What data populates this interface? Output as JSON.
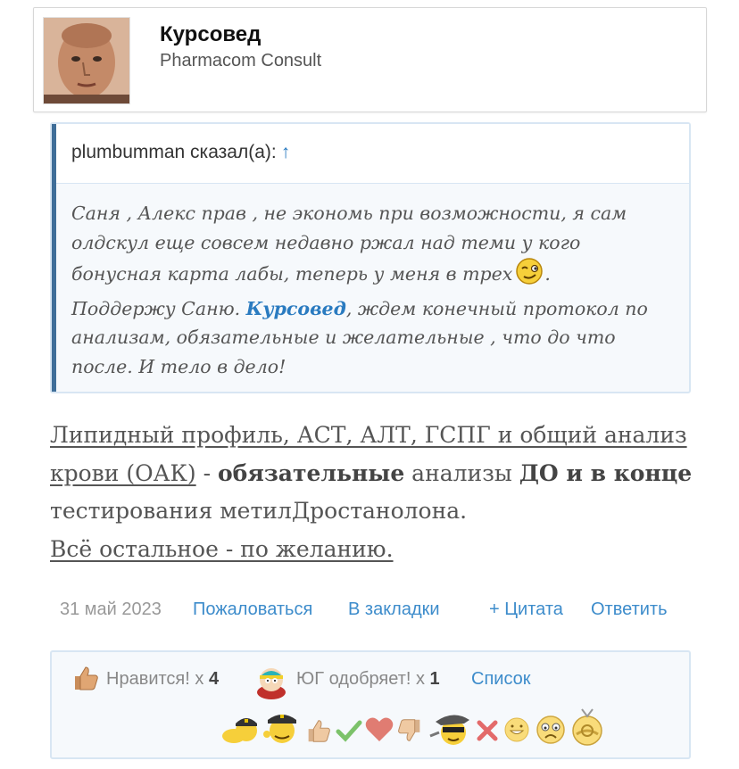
{
  "author": {
    "name": "Курсовед",
    "title": "Pharmacom Consult"
  },
  "quote": {
    "author": "plumbumman сказал(а):",
    "arrow": "↑",
    "line1": "Саня , Алекс прав , не экономь при возможности, я сам",
    "line2": "олдскул еще совсем недавно ржал над теми у кого",
    "line3": "бонусная карта лабы, теперь у меня в трех",
    "line3_end": ".",
    "line4_pre": "Поддержу Саню. ",
    "mention": "Курсовед",
    "line4_post": ", ждем конечный протокол по",
    "line5": "анализам, обязательные и желательные , что до что",
    "line6": "после. И тело в дело!"
  },
  "message": {
    "part1": "Липидный профиль, АСТ, АЛТ, ГСПГ и общий анализ крови (ОАК)",
    "part2": " - ",
    "part3": "обязательные",
    "part4": " анализы ",
    "part5": "ДО и в конце",
    "part6": " тестирования метилДростанолона.",
    "part7": "Всё остальное - по желанию."
  },
  "meta": {
    "date": "31 май 2023",
    "report": "Пожаловаться",
    "bookmark": "В закладки",
    "quote": "+ Цитата",
    "reply": "Ответить"
  },
  "likes": {
    "like_label": "Нравится! x",
    "like_count": "4",
    "approve_label": "ЮГ одобряет! x",
    "approve_count": "1",
    "list": "Список"
  },
  "reaction_icons": [
    "police-face-icon",
    "police-face-icon",
    "thumbs-up-icon",
    "checkmark-icon",
    "heart-icon",
    "thumbs-down-icon",
    "bandit-face-icon",
    "cross-icon",
    "smile-icon",
    "sad-face-icon",
    "trumpet-face-icon"
  ],
  "colors": {
    "link": "#3d8ccb",
    "quote_bar": "#3f6e99",
    "quote_border": "#d8e6f3"
  }
}
